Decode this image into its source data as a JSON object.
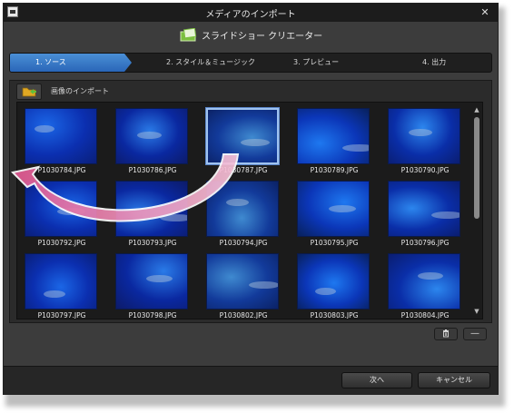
{
  "window": {
    "title": "メディアのインポート",
    "close_glyph": "✕"
  },
  "brand": {
    "name": "スライドショー クリエーター"
  },
  "steps": [
    {
      "label": "1. ソース",
      "active": true
    },
    {
      "label": "2. スタイル＆ミュージック",
      "active": false
    },
    {
      "label": "3. プレビュー",
      "active": false
    },
    {
      "label": "4. 出力",
      "active": false
    }
  ],
  "import": {
    "label": "画像のインポート",
    "icon": "folder-add-icon"
  },
  "thumbnails": [
    {
      "filename": "P1030784.JPG",
      "selected": false
    },
    {
      "filename": "P1030786.JPG",
      "selected": false
    },
    {
      "filename": "P1030787.JPG",
      "selected": true
    },
    {
      "filename": "P1030789.JPG",
      "selected": false
    },
    {
      "filename": "P1030790.JPG",
      "selected": false
    },
    {
      "filename": "P1030792.JPG",
      "selected": false
    },
    {
      "filename": "P1030793.JPG",
      "selected": false
    },
    {
      "filename": "P1030794.JPG",
      "selected": false
    },
    {
      "filename": "P1030795.JPG",
      "selected": false
    },
    {
      "filename": "P1030796.JPG",
      "selected": false
    },
    {
      "filename": "P1030797.JPG",
      "selected": false
    },
    {
      "filename": "P1030798.JPG",
      "selected": false
    },
    {
      "filename": "P1030802.JPG",
      "selected": false
    },
    {
      "filename": "P1030803.JPG",
      "selected": false
    },
    {
      "filename": "P1030804.JPG",
      "selected": false
    }
  ],
  "tools": {
    "delete_icon": "trash-icon",
    "remove_glyph": "—"
  },
  "footer": {
    "next_label": "次へ",
    "cancel_label": "キャンセル"
  },
  "colors": {
    "accent": "#3a7bd5",
    "arrow": "#e889b0",
    "background": "#3c3c3c"
  }
}
